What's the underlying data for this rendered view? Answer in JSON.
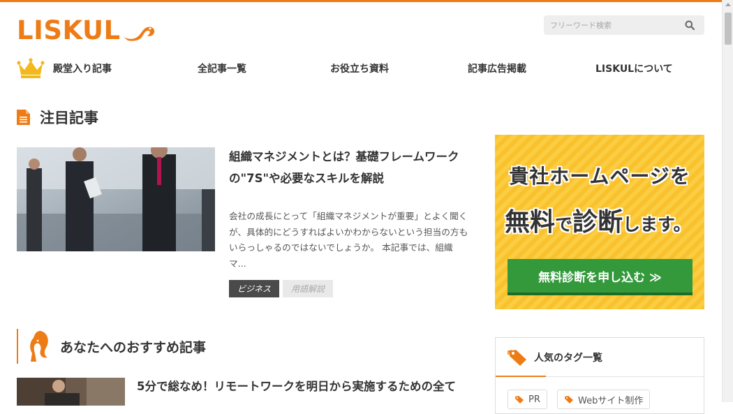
{
  "brand": {
    "logo_text": "LISKUL",
    "accent_color": "#ee7c16"
  },
  "search": {
    "placeholder": "フリーワード検索",
    "icon": "search-icon"
  },
  "nav": {
    "items": [
      {
        "label": "殿堂入り記事",
        "icon": "crown-icon"
      },
      {
        "label": "全記事一覧"
      },
      {
        "label": "お役立ち資料"
      },
      {
        "label": "記事広告掲載"
      },
      {
        "label": "LISKULについて"
      }
    ]
  },
  "featured": {
    "heading": "注目記事",
    "article": {
      "title": "組織マネジメントとは？基礎フレームワークの\"7S\"や必要なスキルを解説",
      "excerpt": "会社の成長にとって「組織マネジメントが重要」とよく聞くが、具体的にどうすればよいかわからないという担当の方もいらっしゃるのではないでしょうか。 本記事では、組織マ...",
      "tags": [
        "ビジネス",
        "用語解説"
      ]
    }
  },
  "banner": {
    "line1": "貴社ホームページを",
    "line2_a": "無料",
    "line2_b": "で",
    "line2_c": "診断",
    "line2_d": "します。",
    "button": "無料診断を申し込む ≫",
    "colors": {
      "background": "#f9c22d",
      "button": "#33993b"
    }
  },
  "recommended": {
    "heading": "あなたへのおすすめ記事",
    "first_title": "5分で総なめ！リモートワークを明日から実施するための全て"
  },
  "tag_list": {
    "heading": "人気のタグ一覧",
    "tags": [
      "PR",
      "Webサイト制作"
    ]
  }
}
